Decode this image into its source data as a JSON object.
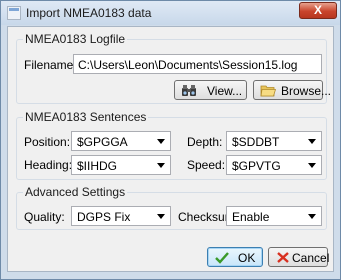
{
  "window": {
    "title": "Import NMEA0183 data",
    "close_glyph": "X"
  },
  "logfile": {
    "legend": "NMEA0183 Logfile",
    "filename_label": "Filename:",
    "filename_value": "C:\\Users\\Leon\\Documents\\Session15.log",
    "view_label": "View...",
    "browse_label": "Browse..."
  },
  "sentences": {
    "legend": "NMEA0183 Sentences",
    "position_label": "Position:",
    "position_value": "$GPGGA",
    "depth_label": "Depth:",
    "depth_value": "$SDDBT",
    "heading_label": "Heading:",
    "heading_value": "$IIHDG",
    "speed_label": "Speed:",
    "speed_value": "$GPVTG"
  },
  "advanced": {
    "legend": "Advanced Settings",
    "quality_label": "Quality:",
    "quality_value": "DGPS Fix",
    "checksum_label": "Checksum:",
    "checksum_value": "Enable"
  },
  "buttons": {
    "ok_label": "OK",
    "cancel_label": "Cancel"
  },
  "icons": {
    "app": "app-window-icon",
    "view": "binoculars-icon",
    "browse": "folder-open-icon",
    "ok": "checkmark-icon",
    "cancel": "cross-icon",
    "dropdown": "chevron-down-icon"
  },
  "colors": {
    "ok_check": "#3a9a2a",
    "cancel_cross": "#d83020",
    "titlebar": "#cfdcea"
  }
}
